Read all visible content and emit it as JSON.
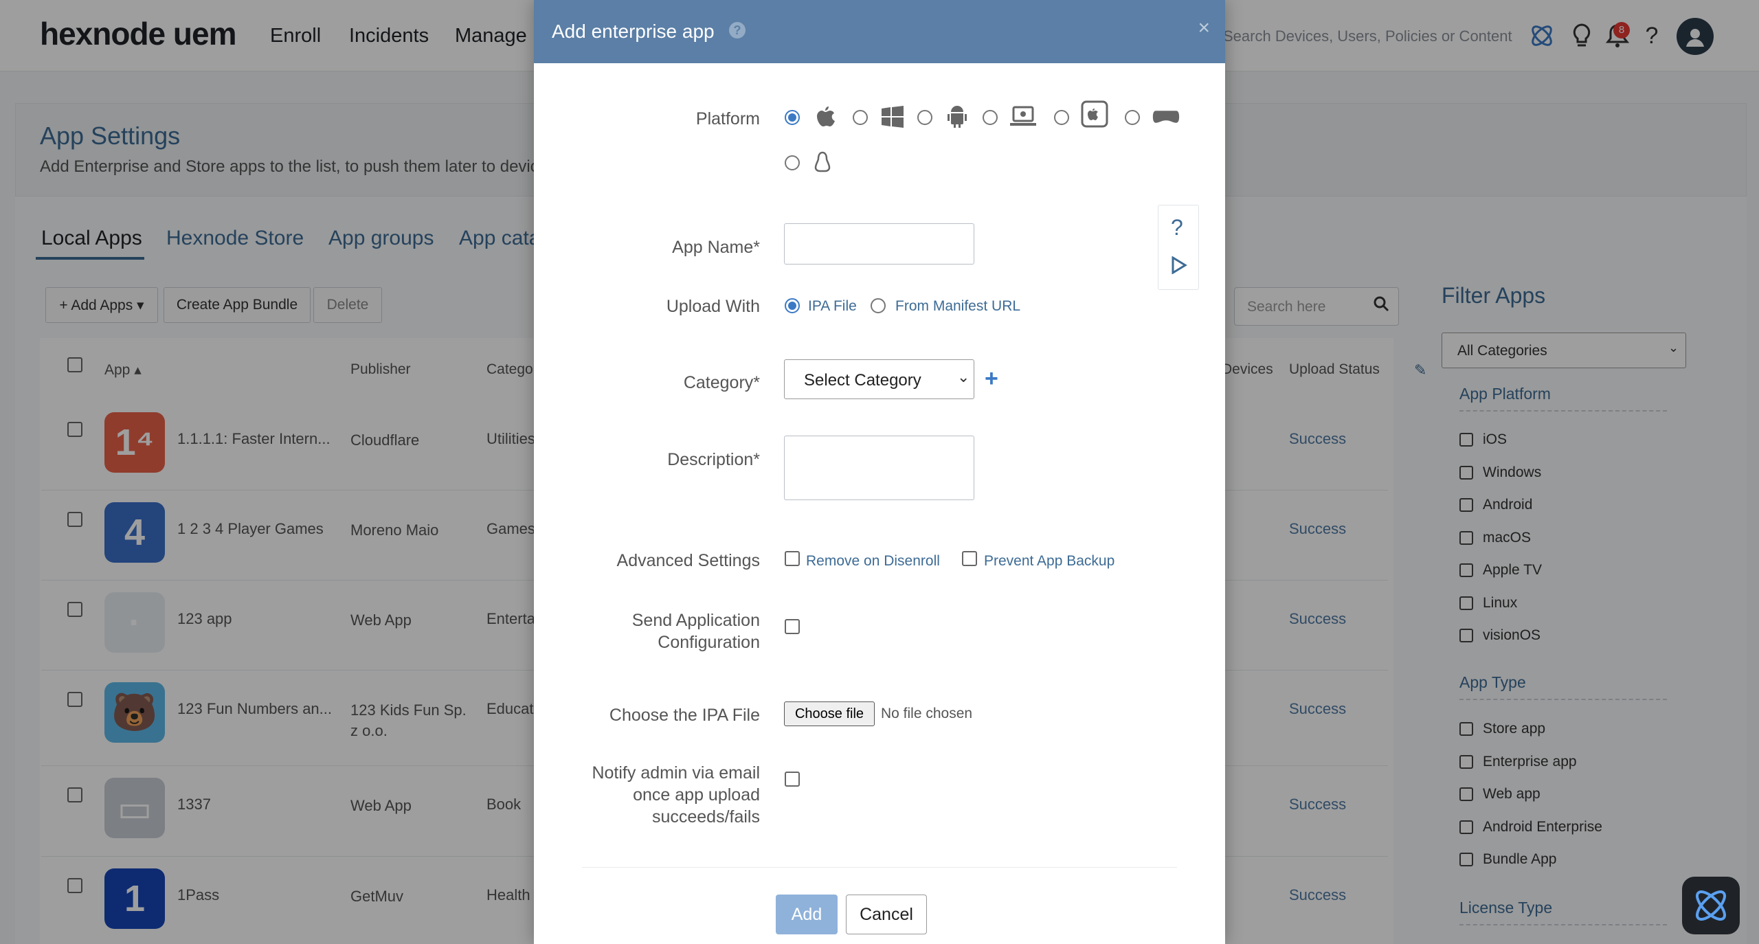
{
  "brand": {
    "logo_text": "hexnode uem",
    "accent": "#3d6b95",
    "modal_header": "#5b7fa6"
  },
  "nav": {
    "items": [
      "Enroll",
      "Incidents",
      "Manage"
    ],
    "search_placeholder": "Search Devices, Users, Policies or Content",
    "notification_count": "8"
  },
  "page": {
    "title": "App Settings",
    "subtitle": "Add Enterprise and Store apps to the list, to push them later to devic"
  },
  "tabs": [
    "Local Apps",
    "Hexnode Store",
    "App groups",
    "App cata"
  ],
  "toolbar": {
    "add_apps": "+ Add Apps ▾",
    "create_bundle": "Create App Bundle",
    "delete": "Delete"
  },
  "table": {
    "headers": {
      "app": "App ▴",
      "publisher": "Publisher",
      "category": "Catego",
      "devices": "Devices",
      "upload_status": "Upload Status"
    },
    "rows": [
      {
        "name": "1.1.1.1: Faster Intern...",
        "publisher": "Cloudflare",
        "category": "Utilities",
        "status": "Success",
        "icon": "1⁴",
        "icon_color": "#e8624a"
      },
      {
        "name": "1 2 3 4 Player Games",
        "publisher": "Moreno Maio",
        "category": "Games",
        "status": "Success",
        "icon": "4",
        "icon_color": "#3a6fc9"
      },
      {
        "name": "123 app",
        "publisher": "Web App",
        "category": "Enterta",
        "status": "Success",
        "icon": "·",
        "icon_color": "#e9edf2"
      },
      {
        "name": "123 Fun Numbers an...",
        "publisher": "123 Kids Fun Sp. z o.o.",
        "category": "Educati",
        "status": "Success",
        "icon": "🐻",
        "icon_color": "#5cb8e8"
      },
      {
        "name": "1337",
        "publisher": "Web App",
        "category": "Book",
        "status": "Success",
        "icon": "▭",
        "icon_color": "#c9ced4"
      },
      {
        "name": "1Pass",
        "publisher": "GetMuv",
        "category": "Health",
        "status": "Success",
        "icon": "1",
        "icon_color": "#1746b8"
      }
    ],
    "search_placeholder": "Search here"
  },
  "filter": {
    "title": "Filter Apps",
    "category_select": "All Categories",
    "platform_title": "App Platform",
    "platforms": [
      "iOS",
      "Windows",
      "Android",
      "macOS",
      "Apple TV",
      "Linux",
      "visionOS"
    ],
    "type_title": "App Type",
    "types": [
      "Store app",
      "Enterprise app",
      "Web app",
      "Android Enterprise",
      "Bundle App"
    ],
    "license_title": "License Type"
  },
  "modal": {
    "title": "Add enterprise app",
    "close": "×",
    "platform_label": "Platform",
    "platform_icons": [
      "apple-icon",
      "windows-icon",
      "android-icon",
      "mac-laptop-icon",
      "apple-tv-icon",
      "vision-headset-icon",
      "linux-icon"
    ],
    "selected_platform": "apple-icon",
    "app_name_label": "App Name*",
    "upload_with_label": "Upload With",
    "upload_options": [
      "IPA File",
      "From Manifest URL"
    ],
    "selected_upload": "IPA File",
    "category_label": "Category*",
    "category_value": "Select Category",
    "description_label": "Description*",
    "advanced_label": "Advanced Settings",
    "advanced_options": [
      "Remove on Disenroll",
      "Prevent App Backup"
    ],
    "config_label_1": "Send Application",
    "config_label_2": "Configuration",
    "file_label": "Choose the IPA File",
    "file_button": "Choose file",
    "file_status": "No file chosen",
    "notify_label_1": "Notify admin via email",
    "notify_label_2": "once app upload",
    "notify_label_3": "succeeds/fails",
    "add_button": "Add",
    "cancel_button": "Cancel"
  }
}
